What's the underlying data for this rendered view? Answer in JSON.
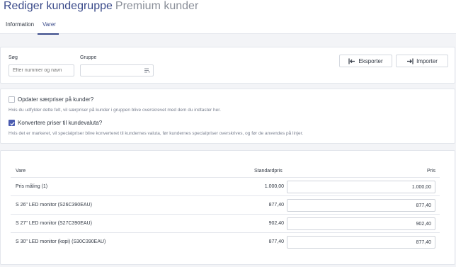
{
  "header": {
    "title": "Rediger kundegruppe",
    "subtitle": "Premium kunder",
    "tabs": [
      {
        "label": "Information",
        "active": false
      },
      {
        "label": "Varer",
        "active": true
      }
    ]
  },
  "filters": {
    "search_label": "Søg",
    "search_placeholder": "Efter nummer og navn",
    "group_label": "Gruppe",
    "group_value": "",
    "export_label": "Eksporter",
    "import_label": "Importer"
  },
  "options": {
    "update_label": "Opdater særpriser på kunder?",
    "update_checked": false,
    "update_help": "Hvis du udfylder dette felt, vil særpriser på kunder i gruppen blive overskrevet med dem du indtaster her.",
    "convert_label": "Konvertere priser til kundevaluta?",
    "convert_checked": true,
    "convert_help": "Hvis det er markeret, vil specialpriser blive konverteret til kundernes valuta, før kundernes specialpriser overskrives, og før de anvendes på linjer."
  },
  "table": {
    "columns": [
      "Vare",
      "Standardpris",
      "Pris"
    ],
    "rows": [
      {
        "name": "Pris måling (1)",
        "standard": "1.000,00",
        "price": "1.000,00"
      },
      {
        "name": "S 26\" LED monitor (S26C390EAU)",
        "standard": "877,40",
        "price": "877,40"
      },
      {
        "name": "S 27\" LED monitor (S27C390EAU)",
        "standard": "902,40",
        "price": "902,40"
      },
      {
        "name": "S 30\" LED monitor (kopi) (S30C390EAU)",
        "standard": "877,40",
        "price": "877,40"
      }
    ]
  },
  "colors": {
    "accent": "#3a4a8a",
    "checkbox": "#4a5bb0"
  },
  "icons": {
    "export": "export-arrow-icon",
    "import": "import-arrow-icon",
    "select": "list-icon",
    "check": "check-icon"
  }
}
